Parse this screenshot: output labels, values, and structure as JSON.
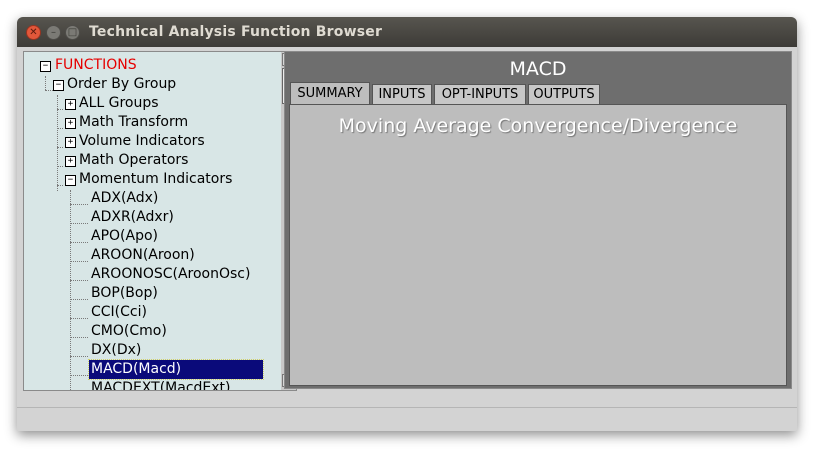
{
  "window": {
    "title": "Technical Analysis Function Browser"
  },
  "tree": {
    "root": "FUNCTIONS",
    "group": "Order By Group",
    "categories": [
      "ALL Groups",
      "Math Transform",
      "Volume Indicators",
      "Math Operators",
      "Momentum Indicators"
    ],
    "momentum_items": [
      "ADX(Adx)",
      "ADXR(Adxr)",
      "APO(Apo)",
      "AROON(Aroon)",
      "AROONOSC(AroonOsc)",
      "BOP(Bop)",
      "CCI(Cci)",
      "CMO(Cmo)",
      "DX(Dx)",
      "MACD(Macd)",
      "MACDEXT(MacdExt)"
    ],
    "selected": "MACD(Macd)",
    "expand_symbol": "+",
    "collapse_symbol": "−"
  },
  "detail": {
    "function_name": "MACD",
    "tabs": [
      "SUMMARY",
      "INPUTS",
      "OPT-INPUTS",
      "OUTPUTS"
    ],
    "active_tab": "SUMMARY",
    "summary": "Moving Average Convergence/Divergence"
  },
  "colors": {
    "root_label": "#e60000",
    "selection": "#0a0a7a",
    "tree_background": "#d8e6e6",
    "header_background": "#6e6e6e"
  }
}
